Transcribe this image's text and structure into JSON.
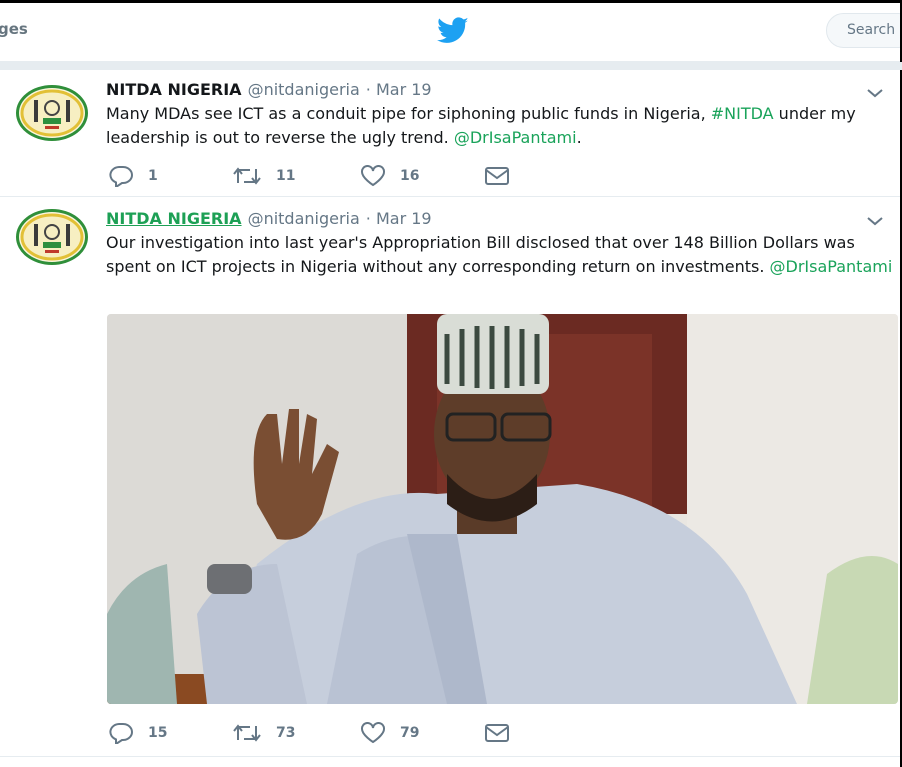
{
  "nav": {
    "messages_label": "ges",
    "search_placeholder": "Search"
  },
  "tweets": [
    {
      "fullname": "NITDA NIGERIA",
      "handle": "@nitdanigeria",
      "date": "· Mar 19",
      "text_parts": [
        "Many MDAs see ICT as a conduit pipe for siphoning public funds in Nigeria, ",
        "#NITDA",
        " under my leadership is out to reverse the ugly trend. ",
        "@DrIsaPantami",
        "."
      ],
      "replies": "1",
      "retweets": "11",
      "likes": "16"
    },
    {
      "fullname": "NITDA NIGERIA",
      "handle": "@nitdanigeria",
      "date": "· Mar 19",
      "text_parts": [
        "Our investigation into last year's Appropriation Bill disclosed that over 148 Billion Dollars was spent on ICT projects in Nigeria without any corresponding return on investments. ",
        "@DrIsaPantami"
      ],
      "replies": "15",
      "retweets": "73",
      "likes": "79"
    }
  ],
  "icons": {
    "logo": "twitter-bird-icon",
    "caret": "chevron-down-icon",
    "reply": "reply-icon",
    "retweet": "retweet-icon",
    "like": "heart-icon",
    "dm": "envelope-icon"
  },
  "colors": {
    "twitter_blue": "#1da1f2",
    "link_green": "#1aa35a",
    "meta_gray": "#657786"
  }
}
